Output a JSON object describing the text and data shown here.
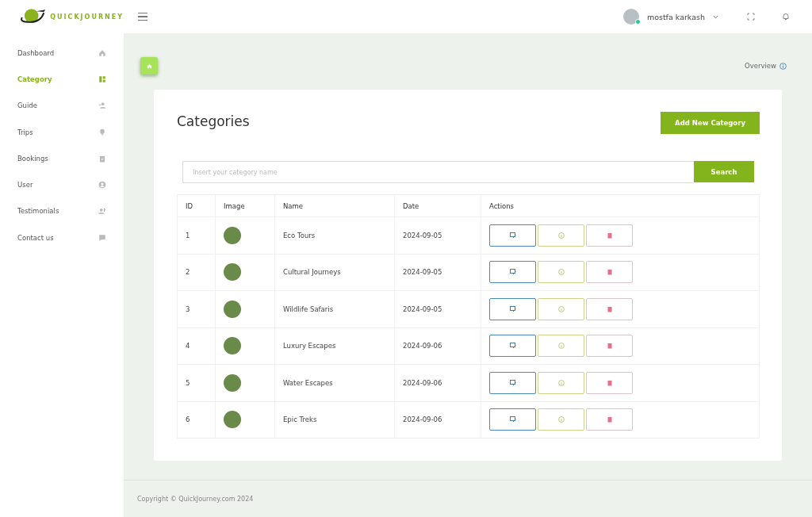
{
  "brand": {
    "name": "QUICKJOURNEY"
  },
  "sidebar": {
    "items": [
      {
        "label": "Dashboard",
        "selected": false
      },
      {
        "label": "Category",
        "selected": true
      },
      {
        "label": "Guide",
        "selected": false
      },
      {
        "label": "Trips",
        "selected": false
      },
      {
        "label": "Bookings",
        "selected": false
      },
      {
        "label": "User",
        "selected": false
      },
      {
        "label": "Testimonials",
        "selected": false
      },
      {
        "label": "Contact us",
        "selected": false
      }
    ]
  },
  "header": {
    "user_name": "mostfa karkash",
    "online": true
  },
  "breadcrumb": {
    "link": "Overview"
  },
  "page": {
    "title": "Categories",
    "add_button": "Add New Category",
    "search": {
      "placeholder": "Insert your category name",
      "button": "Search"
    },
    "table": {
      "columns": [
        "ID",
        "Image",
        "Name",
        "Date",
        "Actions"
      ],
      "rows": [
        {
          "id": "1",
          "name": "Eco Tours",
          "date": "2024-09-05"
        },
        {
          "id": "2",
          "name": "Cultural Journeys",
          "date": "2024-09-05"
        },
        {
          "id": "3",
          "name": "Wildlife Safaris",
          "date": "2024-09-05"
        },
        {
          "id": "4",
          "name": "Luxury Escapes",
          "date": "2024-09-06"
        },
        {
          "id": "5",
          "name": "Water Escapes",
          "date": "2024-09-06"
        },
        {
          "id": "6",
          "name": "Epic Treks",
          "date": "2024-09-06"
        }
      ]
    }
  },
  "footer": {
    "text": "Copyright © QuickJourney.com 2024"
  }
}
